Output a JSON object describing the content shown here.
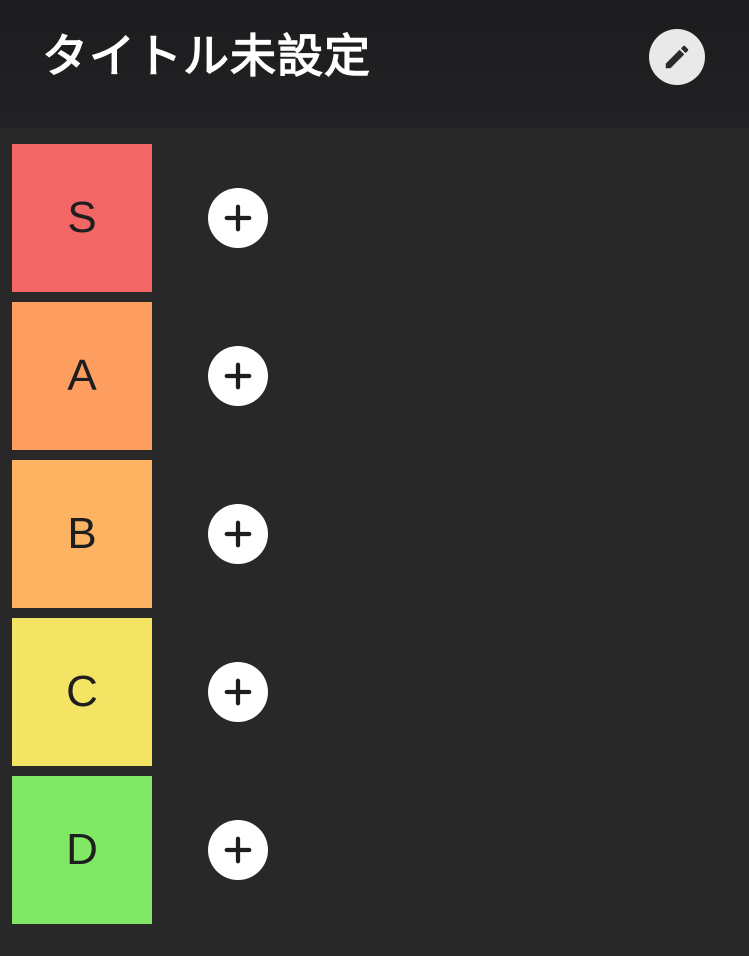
{
  "header": {
    "title": "タイトル未設定",
    "edit_icon": "pencil-icon"
  },
  "tiers": [
    {
      "label": "S",
      "color": "#f26666"
    },
    {
      "label": "A",
      "color": "#fd9d5f"
    },
    {
      "label": "B",
      "color": "#feb363"
    },
    {
      "label": "C",
      "color": "#f4e464"
    },
    {
      "label": "D",
      "color": "#81e865"
    }
  ],
  "add_icon": "plus-icon"
}
